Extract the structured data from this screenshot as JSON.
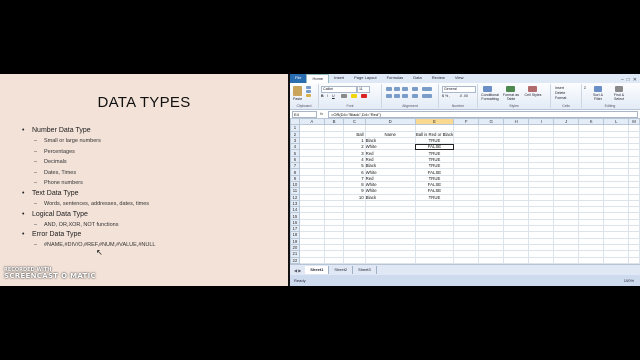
{
  "slide": {
    "title": "DATA TYPES",
    "bullets": [
      {
        "label": "Number Data Type",
        "subs": [
          "Small or large numbers",
          "Percentages",
          "Decimals",
          "Dates, Times",
          "Phone numbers"
        ]
      },
      {
        "label": "Text Data Type",
        "subs": [
          "Words, sentences, addresses, dates, times"
        ]
      },
      {
        "label": "Logical Data Type",
        "subs": [
          "AND, OR,XOR, NOT functions"
        ]
      },
      {
        "label": "Error Data Type",
        "subs": [
          "#NAME,#DIV/O,#REF,#NUM,#VALUE,#NULL"
        ]
      }
    ],
    "watermark_top": "RECORDED WITH",
    "watermark_bottom": "SCREENCAST O MATIC"
  },
  "excel": {
    "ribbon_tabs": [
      "File",
      "Home",
      "Insert",
      "Page Layout",
      "Formulas",
      "Data",
      "Review",
      "View"
    ],
    "active_tab": "Home",
    "font_name": "Calibri",
    "font_size": "11",
    "number_format": "General",
    "groups": [
      "Clipboard",
      "Font",
      "Alignment",
      "Number",
      "Styles",
      "Cells",
      "Editing"
    ],
    "ribbon_labels": {
      "paste": "Paste",
      "conditional": "Conditional Formatting",
      "format_table": "Format as Table",
      "cell_styles": "Cell Styles",
      "insert": "Insert",
      "delete": "Delete",
      "format": "Format",
      "sort": "Sort & Filter",
      "find": "Find & Select"
    },
    "name_box": "E4",
    "fx": "fx",
    "formula": "=OR(D4=\"Black\",D4=\"Red\")",
    "columns": [
      "A",
      "B",
      "C",
      "D",
      "E",
      "F",
      "G",
      "H",
      "I",
      "J",
      "K",
      "L",
      "M"
    ],
    "selected_column": "E",
    "header_row": {
      "ball": "Ball",
      "name": "Name",
      "result": "Ball is Red or Black"
    },
    "rows": [
      {
        "ball": "1",
        "name": "Black",
        "result": "TRUE"
      },
      {
        "ball": "2",
        "name": "White",
        "result": "FALSE"
      },
      {
        "ball": "3",
        "name": "Red",
        "result": "TRUE"
      },
      {
        "ball": "4",
        "name": "Red",
        "result": "TRUE"
      },
      {
        "ball": "5",
        "name": "Black",
        "result": "TRUE"
      },
      {
        "ball": "6",
        "name": "White",
        "result": "FALSE"
      },
      {
        "ball": "7",
        "name": "Red",
        "result": "TRUE"
      },
      {
        "ball": "8",
        "name": "White",
        "result": "FALSE"
      },
      {
        "ball": "9",
        "name": "White",
        "result": "FALSE"
      },
      {
        "ball": "10",
        "name": "Black",
        "result": "TRUE"
      }
    ],
    "total_rows": 25,
    "sheets": [
      "Sheet1",
      "Sheet2",
      "Sheet3"
    ],
    "status": "Ready",
    "zoom": "100%"
  }
}
